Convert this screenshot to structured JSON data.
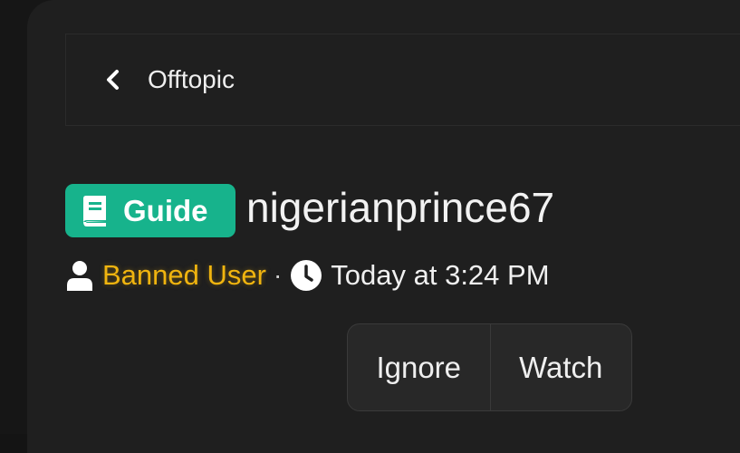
{
  "breadcrumb": {
    "back_icon": "chevron-left-icon",
    "label": "Offtopic"
  },
  "thread": {
    "prefix": {
      "icon": "book-icon",
      "label": "Guide",
      "color": "#17b38c"
    },
    "title": "nigerianprince67",
    "meta": {
      "user_icon": "user-icon",
      "author": "Banned User",
      "author_color": "#f0b40f",
      "separator": "·",
      "clock_icon": "clock-icon",
      "time": "Today at 3:24 PM"
    }
  },
  "actions": {
    "ignore_label": "Ignore",
    "watch_label": "Watch"
  },
  "colors": {
    "background": "#1f1f1f",
    "text": "#f0f0f0"
  }
}
